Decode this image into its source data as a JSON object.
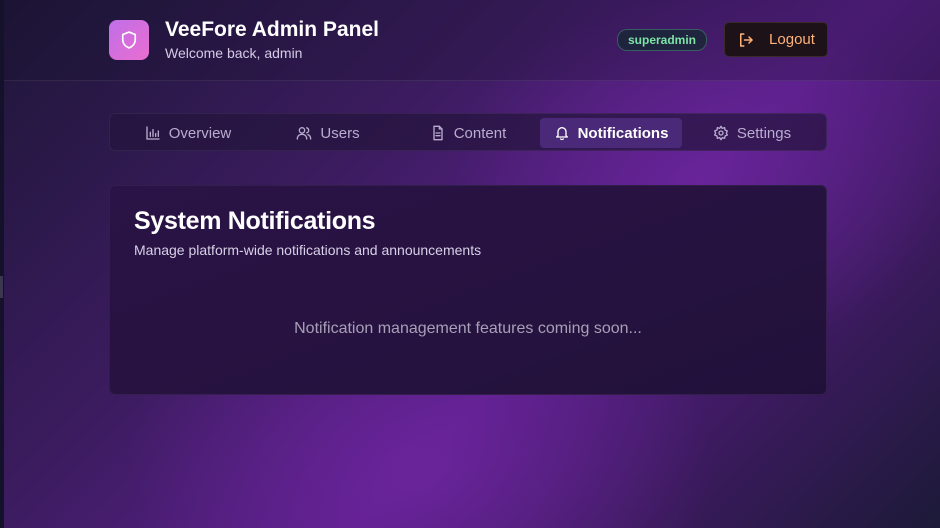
{
  "header": {
    "title": "VeeFore Admin Panel",
    "subtitle": "Welcome back, admin",
    "role_badge": "superadmin",
    "logout_label": "Logout"
  },
  "tabs": [
    {
      "label": "Overview",
      "icon": "bar-chart-icon",
      "active": false
    },
    {
      "label": "Users",
      "icon": "users-icon",
      "active": false
    },
    {
      "label": "Content",
      "icon": "document-icon",
      "active": false
    },
    {
      "label": "Notifications",
      "icon": "bell-icon",
      "active": true
    },
    {
      "label": "Settings",
      "icon": "gear-icon",
      "active": false
    }
  ],
  "card": {
    "title": "System Notifications",
    "subtitle": "Manage platform-wide notifications and announcements",
    "message": "Notification management features coming soon..."
  },
  "colors": {
    "accent": "#4a2a78",
    "badge_text": "#7de3a6",
    "logout_text": "#ffb27a",
    "logo_gradient_start": "#c06ee8",
    "logo_gradient_end": "#e96ed0"
  }
}
